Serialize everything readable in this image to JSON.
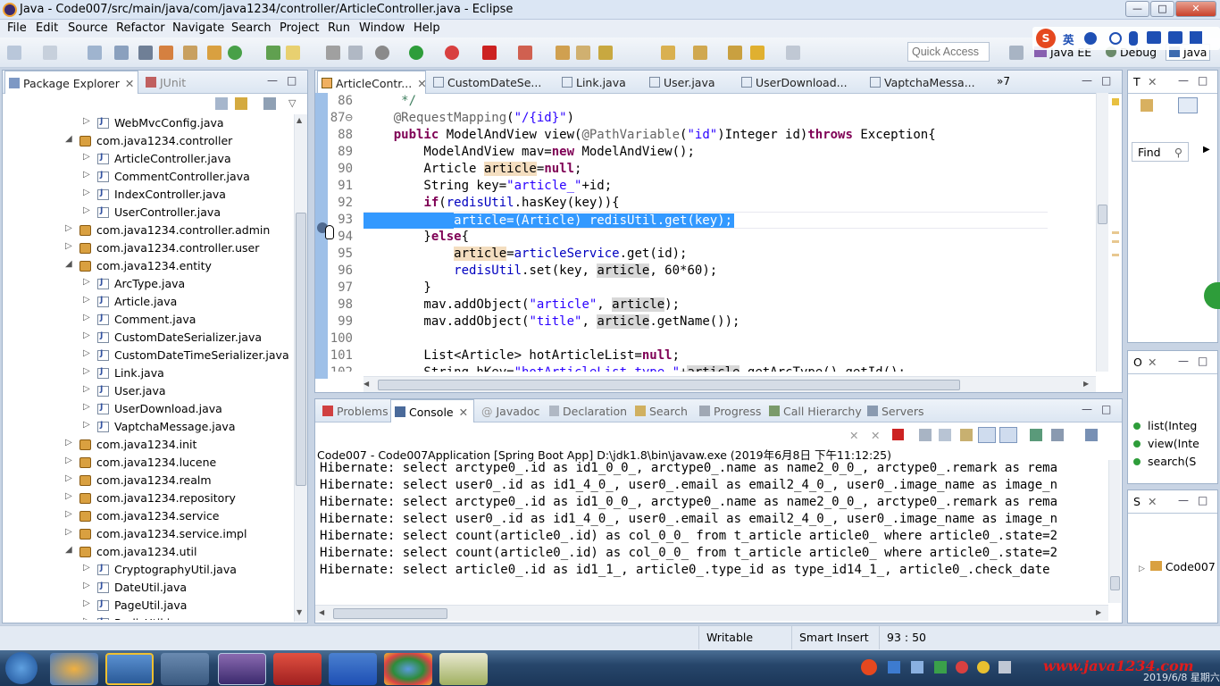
{
  "window": {
    "title": "Java - Code007/src/main/java/com/java1234/controller/ArticleController.java - Eclipse",
    "minimize": "—",
    "maximize": "□",
    "close": "✕"
  },
  "menu": [
    "File",
    "Edit",
    "Source",
    "Refactor",
    "Navigate",
    "Search",
    "Project",
    "Run",
    "Window",
    "Help"
  ],
  "toolbar": {
    "quick_access": "Quick Access",
    "perspectives": [
      "Java EE",
      "Debug",
      "Java"
    ],
    "ime_text": "英"
  },
  "package_explorer": {
    "tabs": [
      "Package Explorer",
      "JUnit"
    ],
    "rows": [
      {
        "label": "WebMvcConfig.java",
        "type": "java",
        "indent": 2,
        "arrow": "▷"
      },
      {
        "label": "com.java1234.controller",
        "type": "pkg",
        "indent": 1,
        "arrow": "◢"
      },
      {
        "label": "ArticleController.java",
        "type": "java",
        "indent": 2,
        "arrow": "▷"
      },
      {
        "label": "CommentController.java",
        "type": "java",
        "indent": 2,
        "arrow": "▷"
      },
      {
        "label": "IndexController.java",
        "type": "java",
        "indent": 2,
        "arrow": "▷"
      },
      {
        "label": "UserController.java",
        "type": "java",
        "indent": 2,
        "arrow": "▷"
      },
      {
        "label": "com.java1234.controller.admin",
        "type": "pkg",
        "indent": 1,
        "arrow": "▷"
      },
      {
        "label": "com.java1234.controller.user",
        "type": "pkg",
        "indent": 1,
        "arrow": "▷"
      },
      {
        "label": "com.java1234.entity",
        "type": "pkg",
        "indent": 1,
        "arrow": "◢"
      },
      {
        "label": "ArcType.java",
        "type": "java",
        "indent": 2,
        "arrow": "▷"
      },
      {
        "label": "Article.java",
        "type": "java",
        "indent": 2,
        "arrow": "▷"
      },
      {
        "label": "Comment.java",
        "type": "java",
        "indent": 2,
        "arrow": "▷"
      },
      {
        "label": "CustomDateSerializer.java",
        "type": "java",
        "indent": 2,
        "arrow": "▷"
      },
      {
        "label": "CustomDateTimeSerializer.java",
        "type": "java",
        "indent": 2,
        "arrow": "▷"
      },
      {
        "label": "Link.java",
        "type": "java",
        "indent": 2,
        "arrow": "▷"
      },
      {
        "label": "User.java",
        "type": "java",
        "indent": 2,
        "arrow": "▷"
      },
      {
        "label": "UserDownload.java",
        "type": "java",
        "indent": 2,
        "arrow": "▷"
      },
      {
        "label": "VaptchaMessage.java",
        "type": "java",
        "indent": 2,
        "arrow": "▷"
      },
      {
        "label": "com.java1234.init",
        "type": "pkg",
        "indent": 1,
        "arrow": "▷"
      },
      {
        "label": "com.java1234.lucene",
        "type": "pkg",
        "indent": 1,
        "arrow": "▷"
      },
      {
        "label": "com.java1234.realm",
        "type": "pkg",
        "indent": 1,
        "arrow": "▷"
      },
      {
        "label": "com.java1234.repository",
        "type": "pkg",
        "indent": 1,
        "arrow": "▷"
      },
      {
        "label": "com.java1234.service",
        "type": "pkg",
        "indent": 1,
        "arrow": "▷"
      },
      {
        "label": "com.java1234.service.impl",
        "type": "pkg",
        "indent": 1,
        "arrow": "▷"
      },
      {
        "label": "com.java1234.util",
        "type": "pkg",
        "indent": 1,
        "arrow": "◢"
      },
      {
        "label": "CryptographyUtil.java",
        "type": "java",
        "indent": 2,
        "arrow": "▷"
      },
      {
        "label": "DateUtil.java",
        "type": "java",
        "indent": 2,
        "arrow": "▷"
      },
      {
        "label": "PageUtil.java",
        "type": "java",
        "indent": 2,
        "arrow": "▷"
      },
      {
        "label": "RedisUtil.java",
        "type": "java",
        "indent": 2,
        "arrow": "▷"
      }
    ]
  },
  "editor": {
    "tabs": [
      "ArticleContr...",
      "CustomDateSe...",
      "Link.java",
      "User.java",
      "UserDownload...",
      "VaptchaMessa..."
    ],
    "overflow": "»7",
    "lines": [
      {
        "n": "86",
        "html": "     <span class='cmt'>*/</span>"
      },
      {
        "n": "87⊖",
        "html": "    <span class='ann'>@RequestMapping</span>(<span class='str'>\"/{id}\"</span>)"
      },
      {
        "n": "88",
        "html": "    <span class='kw'>public</span> ModelAndView view(<span class='ann'>@PathVariable</span>(<span class='str'>\"id\"</span>)Integer id)<span class='kw'>throws</span> Exception{"
      },
      {
        "n": "89",
        "html": "        ModelAndView mav=<span class='kw'>new</span> ModelAndView();"
      },
      {
        "n": "90",
        "html": "        Article <span class='occ'>article</span>=<span class='kw'>null</span>;"
      },
      {
        "n": "91",
        "html": "        String key=<span class='str'>\"article_\"</span>+id;"
      },
      {
        "n": "92",
        "html": "        <span class='kw'>if</span>(<span class='fld'>redisUtil</span>.hasKey(key)){"
      },
      {
        "n": "93",
        "html": "            article=(Article) redisUtil.get(key);",
        "sel": true
      },
      {
        "n": "94",
        "html": "        }<span class='kw'>else</span>{"
      },
      {
        "n": "95",
        "html": "            <span class='occ'>article</span>=<span class='fld'>articleService</span>.get(id);"
      },
      {
        "n": "96",
        "html": "            <span class='fld'>redisUtil</span>.set(key, <span class='occg'>article</span>, 60*60);"
      },
      {
        "n": "97",
        "html": "        }"
      },
      {
        "n": "98",
        "html": "        mav.addObject(<span class='str'>\"article\"</span>, <span class='occg'>article</span>);"
      },
      {
        "n": "99",
        "html": "        mav.addObject(<span class='str'>\"title\"</span>, <span class='occg'>article</span>.getName());"
      },
      {
        "n": "100",
        "html": ""
      },
      {
        "n": "101",
        "html": "        List&lt;Article&gt; hotArticleList=<span class='kw'>null</span>;"
      },
      {
        "n": "102",
        "html": "        String hKey=<span class='str'>\"hotArticleList_type_\"</span>+<span class='occg'>article</span>.getArcType().getId();"
      }
    ]
  },
  "bottom": {
    "tabs": [
      "Problems",
      "Console",
      "Javadoc",
      "Declaration",
      "Search",
      "Progress",
      "Call Hierarchy",
      "Servers"
    ],
    "console_header": "Code007 - Code007Application [Spring Boot App] D:\\jdk1.8\\bin\\javaw.exe (2019年6月8日 下午11:12:25)",
    "lines": [
      "Hibernate: select arctype0_.id as id1_0_0_, arctype0_.name as name2_0_0_, arctype0_.remark as rema",
      "Hibernate: select user0_.id as id1_4_0_, user0_.email as email2_4_0_, user0_.image_name as image_n",
      "Hibernate: select arctype0_.id as id1_0_0_, arctype0_.name as name2_0_0_, arctype0_.remark as rema",
      "Hibernate: select user0_.id as id1_4_0_, user0_.email as email2_4_0_, user0_.image_name as image_n",
      "Hibernate: select count(article0_.id) as col_0_0_ from t_article article0_ where article0_.state=2",
      "Hibernate: select count(article0_.id) as col_0_0_ from t_article article0_ where article0_.state=2",
      "Hibernate: select article0_.id as id1_1_, article0_.type_id as type_id14_1_, article0_.check_date"
    ]
  },
  "right": {
    "task_tab": "T",
    "find": "Find",
    "outline_tab": "O",
    "outline_items": [
      "list(Integ",
      "view(Inte",
      "search(S"
    ],
    "server_tab": "S",
    "server_item": "Code007"
  },
  "status": {
    "writable": "Writable",
    "insert": "Smart Insert",
    "position": "93 : 50"
  },
  "taskbar": {
    "brand": "www.java1234.com",
    "date": "2019/6/8 星期六"
  }
}
